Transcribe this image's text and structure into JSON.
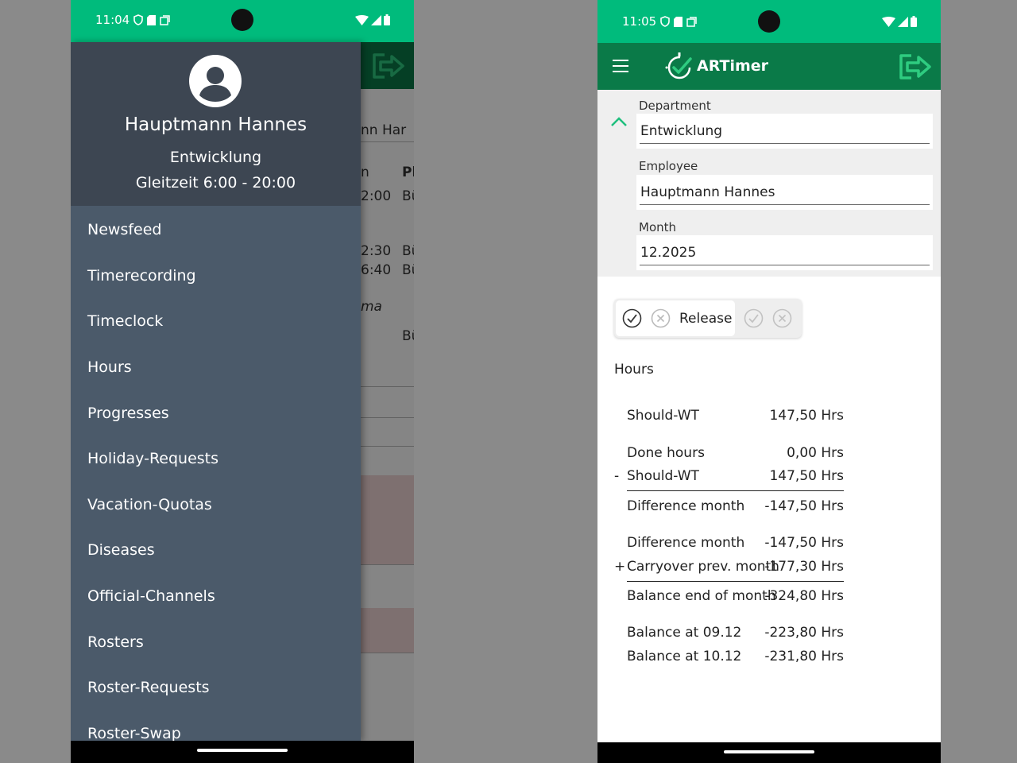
{
  "left": {
    "status": {
      "time": "11:04"
    },
    "background_fragments": [
      "nn Har",
      "n",
      "Pl",
      "2:00",
      "Bü",
      "2:30",
      "Bü",
      "6:40",
      "Bü",
      "ma",
      "Bü"
    ],
    "drawer": {
      "user_name": "Hauptmann Hannes",
      "department": "Entwicklung",
      "work_model": "Gleitzeit 6:00 - 20:00",
      "items": [
        {
          "label": "Newsfeed"
        },
        {
          "label": "Timerecording"
        },
        {
          "label": "Timeclock"
        },
        {
          "label": "Hours"
        },
        {
          "label": "Progresses"
        },
        {
          "label": "Holiday-Requests"
        },
        {
          "label": "Vacation-Quotas"
        },
        {
          "label": "Diseases"
        },
        {
          "label": "Official-Channels"
        },
        {
          "label": "Rosters"
        },
        {
          "label": "Roster-Requests"
        },
        {
          "label": "Roster-Swap"
        }
      ]
    }
  },
  "right": {
    "status": {
      "time": "11:05"
    },
    "app_title": "ARTimer",
    "filters": {
      "department_label": "Department",
      "department_value": "Entwicklung",
      "employee_label": "Employee",
      "employee_value": "Hauptmann Hannes",
      "month_label": "Month",
      "month_value": "12.2025"
    },
    "release_label": "Release",
    "hours_title": "Hours",
    "hours_rows": [
      {
        "sign": "",
        "label": "Should-WT",
        "value": "147,50 Hrs"
      },
      {
        "sign": "",
        "label": "Done hours",
        "value": "0,00 Hrs"
      },
      {
        "sign": "-",
        "label": "Should-WT",
        "value": "147,50 Hrs"
      },
      {
        "sign": "",
        "label": "Difference month",
        "value": "-147,50 Hrs"
      },
      {
        "sign": "",
        "label": "Difference month",
        "value": "-147,50 Hrs"
      },
      {
        "sign": "+",
        "label": "Carryover prev. month",
        "value": "-177,30 Hrs"
      },
      {
        "sign": "",
        "label": "Balance end of month",
        "value": "-324,80 Hrs"
      },
      {
        "sign": "",
        "label": "Balance at 09.12",
        "value": "-223,80 Hrs"
      },
      {
        "sign": "",
        "label": "Balance at 10.12",
        "value": "-231,80 Hrs"
      }
    ],
    "colors": {
      "status_green": "#00bb7c",
      "appbar_green": "#0a7a48",
      "accent": "#1fbf7e"
    }
  }
}
